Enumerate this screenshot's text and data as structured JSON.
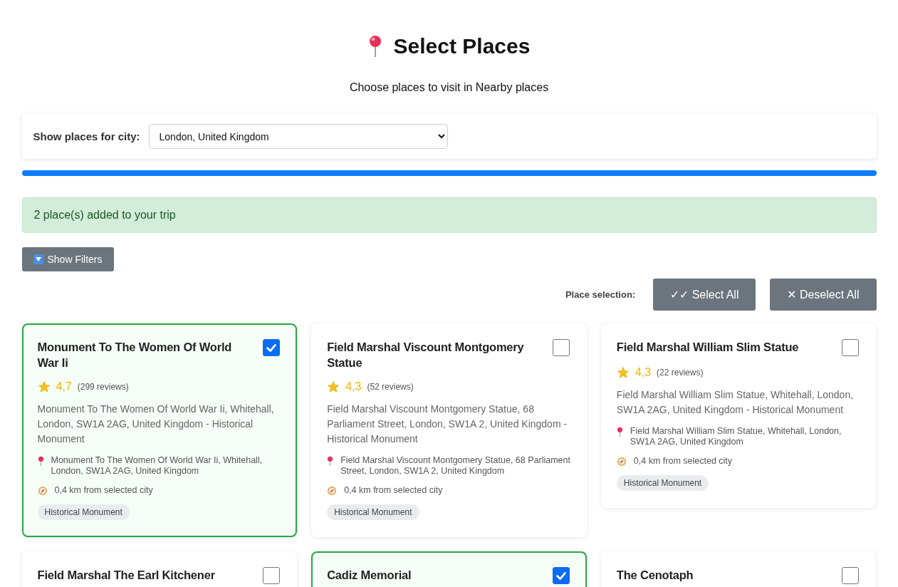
{
  "header": {
    "title": "Select Places",
    "subtitle": "Choose places to visit in Nearby places"
  },
  "city_filter": {
    "label": "Show places for city:",
    "value": "London, United Kingdom"
  },
  "progress": {
    "level": 1
  },
  "alert": "2 place(s) added to your trip",
  "filters_button": "Show Filters",
  "selection": {
    "label": "Place selection:",
    "buttons": [
      "✓✓ Select All",
      "✕ Deselect All"
    ]
  },
  "places": [
    {
      "title": "Monument To The Women Of World War Ii",
      "selected": true,
      "rating": "4,7",
      "reviews": "(299 reviews)",
      "description": "Monument To The Women Of World War Ii, Whitehall, London, SW1A 2AG, United Kingdom - Historical Monument",
      "address": "Monument To The Women Of World War Ii, Whitehall, London, SW1A 2AG, United Kingdom",
      "distance": "0,4 km from selected city",
      "tag": "Historical Monument"
    },
    {
      "title": "Field Marshal Viscount Montgomery Statue",
      "selected": false,
      "rating": "4,3",
      "reviews": "(52 reviews)",
      "description": "Field Marshal Viscount Montgomery Statue, 68 Parliament Street, London, SW1A 2, United Kingdom - Historical Monument",
      "address": "Field Marshal Viscount Montgomery Statue, 68 Parliament Street, London, SW1A 2, United Kingdom",
      "distance": "0,4 km from selected city",
      "tag": "Historical Monument"
    },
    {
      "title": "Field Marshal William Slim Statue",
      "selected": false,
      "rating": "4,3",
      "reviews": "(22 reviews)",
      "description": "Field Marshal William Slim Statue, Whitehall, London, SW1A 2AG, United Kingdom - Historical Monument",
      "address": "Field Marshal William Slim Statue, Whitehall, London, SW1A 2AG, United Kingdom",
      "distance": "0,4 km from selected city",
      "tag": "Historical Monument"
    },
    {
      "title": "Field Marshal The Earl Kitchener",
      "selected": false
    },
    {
      "title": "Cadiz Memorial",
      "selected": true
    },
    {
      "title": "The Cenotaph",
      "selected": false
    }
  ]
}
